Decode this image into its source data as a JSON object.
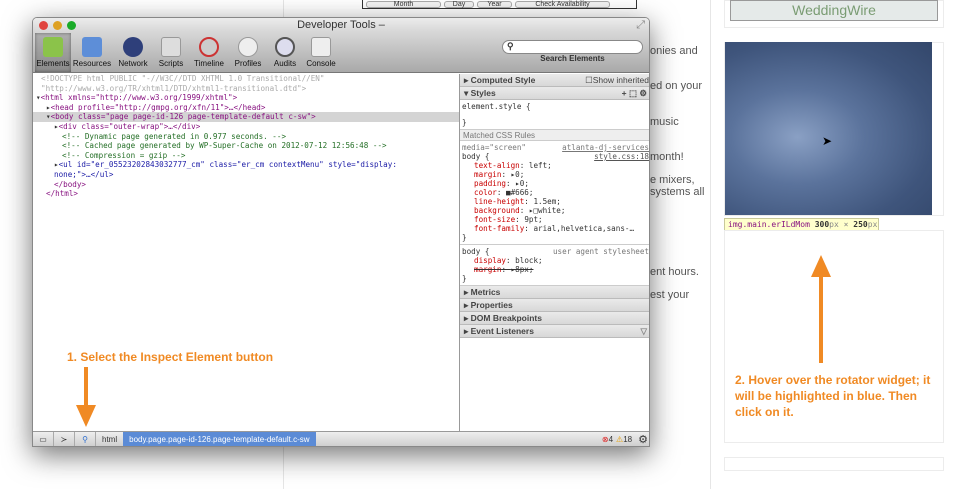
{
  "background_page": {
    "form": {
      "month": "Month",
      "day": "Day",
      "year": "Year",
      "check": "Check Availability"
    },
    "text_fragments": [
      "onies and",
      "ed on your",
      "music",
      "month!",
      "e mixers,",
      "systems all",
      "ent hours.",
      "est your"
    ],
    "wedding_wire": "WeddingWire",
    "tooltip": {
      "selector": "img.main.erILdMom",
      "width": "300",
      "height": "250",
      "unit": "px",
      "times": "×"
    }
  },
  "annotations": {
    "step1": "1. Select the Inspect Element button",
    "step2": "2. Hover over the rotator widget; it will be highlighted in blue. Then click on it.",
    "color": "#f08a24"
  },
  "devtools": {
    "title": "Developer Tools –",
    "tabs": [
      {
        "label": "Elements",
        "icon": "elements-icon"
      },
      {
        "label": "Resources",
        "icon": "resources-icon"
      },
      {
        "label": "Network",
        "icon": "network-icon"
      },
      {
        "label": "Scripts",
        "icon": "scripts-icon"
      },
      {
        "label": "Timeline",
        "icon": "timeline-icon"
      },
      {
        "label": "Profiles",
        "icon": "profiles-icon"
      },
      {
        "label": "Audits",
        "icon": "audits-icon"
      },
      {
        "label": "Console",
        "icon": "console-icon"
      }
    ],
    "search_label": "Search Elements",
    "dom": {
      "doctype1": "<!DOCTYPE html PUBLIC \"-//W3C//DTD XHTML 1.0 Transitional//EN\"",
      "doctype2": "\"http://www.w3.org/TR/xhtml1/DTD/xhtml1-transitional.dtd\">",
      "html": "<html xmlns=\"http://www.w3.org/1999/xhtml\">",
      "head": "<head profile=\"http://gmpg.org/xfn/11\">…</head>",
      "body": "<body class=\"page page-id-126 page-template-default c-sw\">",
      "div": "<div class=\"outer-wrap\">…</div>",
      "c1": "<!-- Dynamic page generated in 0.977 seconds. -->",
      "c2": "<!-- Cached page generated by WP-Super-Cache on 2012-07-12 12:56:48 -->",
      "c3": "<!-- Compression = gzip -->",
      "ul1": "<ul id=\"er_05523202843032777_cm\" class=\"er_cm contextMenu\" style=\"display:",
      "ul2": "none;\">…</ul>",
      "body_close": "</body>",
      "html_close": "</html>"
    },
    "sidebar": {
      "computed": "Computed Style",
      "show_inherited": "Show inherited",
      "styles": "Styles",
      "element_style": "element.style {",
      "close": "}",
      "matched": "Matched CSS Rules",
      "media": "media=\"screen\"",
      "source1": "atlanta-dj-services",
      "source2": "style.css:18",
      "body_open": "body {",
      "props": [
        [
          "text-align",
          "left;"
        ],
        [
          "margin",
          "▸0;"
        ],
        [
          "padding",
          "▸0;"
        ],
        [
          "color",
          "■#666;"
        ],
        [
          "line-height",
          "1.5em;"
        ],
        [
          "background",
          "▸□white;"
        ],
        [
          "font-size",
          "9pt;"
        ],
        [
          "font-family",
          "arial,helvetica,sans-…"
        ]
      ],
      "ua": "user agent stylesheet",
      "ua_props": [
        [
          "display",
          "block;"
        ],
        [
          "margin",
          "▸8px;"
        ]
      ],
      "metrics": "Metrics",
      "properties": "Properties",
      "dom_breakpoints": "DOM Breakpoints",
      "event_listeners": "Event Listeners"
    },
    "status": {
      "crumb_html": "html",
      "crumb_body": "body.page.page-id-126.page-template-default.c-sw",
      "errors": "4",
      "warnings": "18"
    }
  }
}
